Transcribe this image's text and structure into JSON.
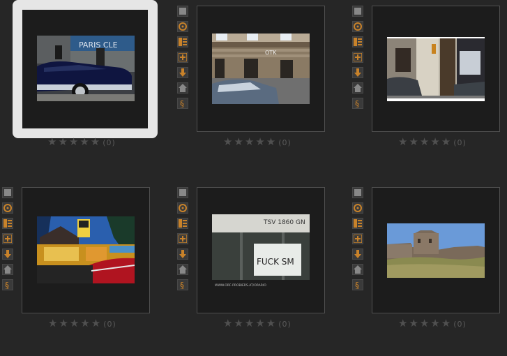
{
  "colors": {
    "toolbar_accent": "#c8822a",
    "frame_bg": "#1c1c1c",
    "selected_border": "#e6e6e6",
    "star": "#505050"
  },
  "toolbar_icons": [
    "checkbox-icon",
    "circle-target-icon",
    "list-icon",
    "plus-icon",
    "arrow-down-icon",
    "home-icon",
    "section-icon"
  ],
  "rating": {
    "stars": "★★★★★",
    "count": "(0)"
  },
  "photos": [
    {
      "name": "classic-car-paris",
      "sign_text": "PARIS CLE",
      "selected": true
    },
    {
      "name": "building-facade-graffiti",
      "sign_text": "",
      "selected": false
    },
    {
      "name": "shop-front-street",
      "sign_text": "",
      "selected": false
    },
    {
      "name": "night-diner-car",
      "sign_text": "",
      "selected": false
    },
    {
      "name": "graffiti-window",
      "sign_text": "TSV 1860 GN",
      "sign_text_2": "FUCK SM",
      "footer": "WWW.ORF-PROBIERS.AT/ORARIO",
      "selected": false
    },
    {
      "name": "fortress-ruins",
      "sign_text": "",
      "selected": false
    }
  ]
}
